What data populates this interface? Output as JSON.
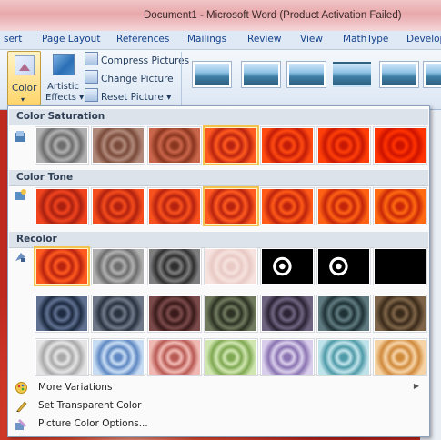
{
  "window": {
    "title": "Document1 - Microsoft Word (Product Activation Failed)"
  },
  "tabs": [
    "sert",
    "Page Layout",
    "References",
    "Mailings",
    "Review",
    "View",
    "MathType",
    "Develop"
  ],
  "ribbon": {
    "color_button": "Color",
    "artistic_effects_line1": "Artistic",
    "artistic_effects_line2": "Effects ▾",
    "compress_pictures": "Compress Pictures",
    "change_picture": "Change Picture",
    "reset_picture": "Reset Picture ▾"
  },
  "gallery": {
    "sections": [
      {
        "title": "Color Saturation",
        "icon": "saturation-icon",
        "selected_index": 3,
        "rows": 1,
        "items": [
          "grayscale",
          "desaturated",
          "muted",
          "original",
          "saturated",
          "vivid",
          "extra-vivid"
        ]
      },
      {
        "title": "Color Tone",
        "icon": "color-tone-icon",
        "selected_index": 3,
        "rows": 1,
        "items": [
          "cool",
          "cooler",
          "neutral",
          "original",
          "warm",
          "warmer",
          "hot"
        ]
      },
      {
        "title": "Recolor",
        "icon": "recolor-icon",
        "selected_index": 0,
        "rows": 3,
        "items": [
          "no-recolor",
          "grayscale",
          "sepia",
          "washout",
          "black-white-25",
          "black-white-50",
          "black-white-75",
          "dark-blue",
          "dark-slate",
          "dark-red",
          "dark-olive",
          "dark-purple",
          "dark-teal",
          "dark-brown",
          "light-gray",
          "light-blue",
          "light-red",
          "light-green",
          "light-purple",
          "light-teal",
          "light-orange"
        ]
      }
    ],
    "menu": [
      {
        "label": "More Variations",
        "icon": "palette-icon",
        "has_submenu": true
      },
      {
        "label": "Set Transparent Color",
        "icon": "pen-icon",
        "has_submenu": false
      },
      {
        "label": "Picture Color Options...",
        "icon": "color-options-icon",
        "has_submenu": false
      }
    ]
  },
  "colors": {
    "selection_border": "#f2c24f",
    "ribbon_text": "#15428b",
    "title_bar": "#e8a8ab"
  }
}
